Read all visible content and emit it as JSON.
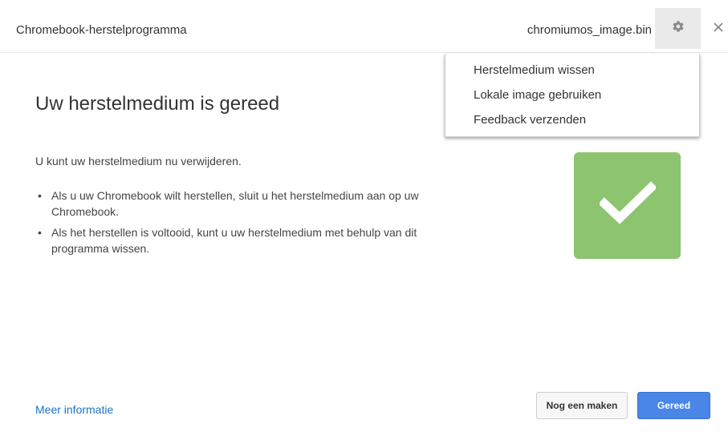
{
  "window": {
    "title": "Chromebook-herstelprogramma",
    "file_name": "chromiumos_image.bin",
    "settings_icon": "gear-icon",
    "close_icon": "close-icon"
  },
  "settings_menu": {
    "items": [
      {
        "label": "Herstelmedium wissen"
      },
      {
        "label": "Lokale image gebruiken"
      },
      {
        "label": "Feedback verzenden"
      }
    ]
  },
  "main": {
    "heading": "Uw herstelmedium is gereed",
    "intro": "U kunt uw herstelmedium nu verwijderen.",
    "bullets": [
      {
        "text": "Als u uw Chromebook wilt herstellen, sluit u het herstelmedium aan op uw Chromebook."
      },
      {
        "text": "Als het herstellen is voltooid, kunt u uw herstelmedium met behulp van dit programma wissen."
      }
    ],
    "status_icon": "checkmark-icon"
  },
  "footer": {
    "more_info_link": "Meer informatie",
    "secondary_button": "Nog een maken",
    "primary_button": "Gereed"
  },
  "colors": {
    "accent": "#4a86e8",
    "success": "#8cc46f",
    "link": "#1a73c8"
  }
}
